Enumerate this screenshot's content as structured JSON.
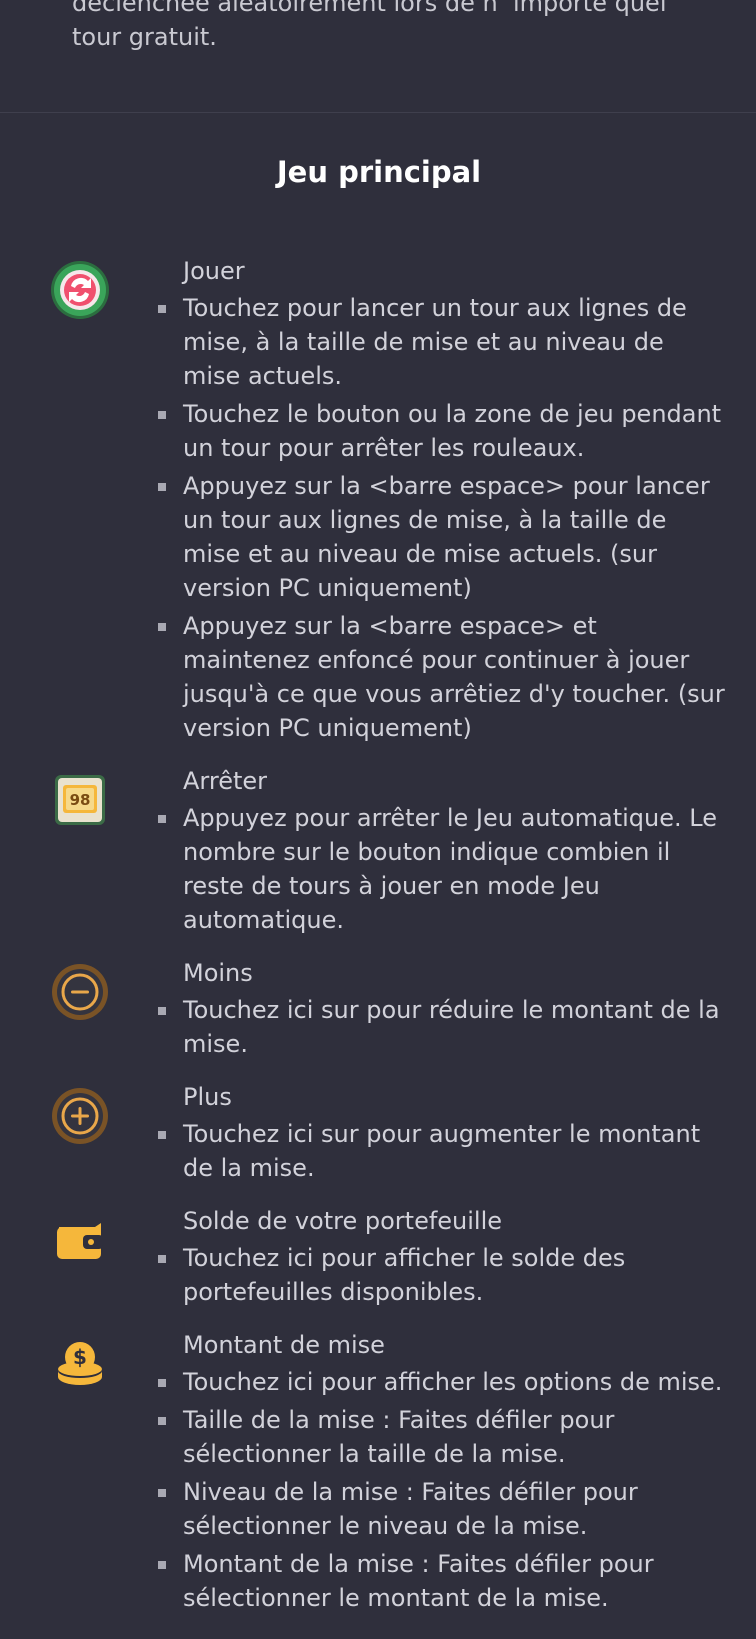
{
  "top": {
    "text": "déclenchée aléatoirement lors de n’ importe quel tour gratuit."
  },
  "section": {
    "title": "Jeu principal"
  },
  "items": [
    {
      "icon": "spin-icon",
      "title": "Jouer",
      "bullets": [
        "Touchez pour lancer un tour aux lignes de mise, à la taille de mise et au niveau de mise actuels.",
        "Touchez le bouton ou la zone de jeu pendant un tour pour arrêter les rouleaux.",
        "Appuyez sur la <barre espace> pour lancer un tour aux lignes de mise, à la taille de mise et au niveau de mise actuels. (sur version PC uniquement)",
        "Appuyez sur la <barre espace> et maintenez enfoncé pour continuer à jouer jusqu'à ce que vous arrêtiez d'y toucher. (sur version PC uniquement)"
      ]
    },
    {
      "icon": "autoplay-stop-icon",
      "icon_text": "98",
      "title": "Arrêter",
      "bullets": [
        "Appuyez pour arrêter le Jeu automatique. Le nombre sur le bouton indique combien il reste de tours à jouer en mode Jeu automatique."
      ]
    },
    {
      "icon": "minus-icon",
      "title": "Moins",
      "bullets": [
        "Touchez ici sur pour réduire le montant de la mise."
      ]
    },
    {
      "icon": "plus-icon",
      "title": "Plus",
      "bullets": [
        "Touchez ici sur pour augmenter le montant de la mise."
      ]
    },
    {
      "icon": "wallet-icon",
      "title": "Solde de votre portefeuille",
      "bullets": [
        "Touchez ici pour afficher le solde des portefeuilles disponibles."
      ]
    },
    {
      "icon": "coins-icon",
      "title": "Montant de mise",
      "bullets": [
        "Touchez ici pour afficher les options de mise.",
        "Taille de la mise : Faites défiler pour sélectionner la taille de la mise.",
        "Niveau de la mise : Faites défiler pour sélectionner le niveau de la mise.",
        "Montant de la mise : Faites défiler pour sélectionner le montant de la mise."
      ]
    }
  ],
  "colors": {
    "background": "#2f2f3c",
    "accent_gold": "#f5b73b",
    "spin_green": "#3aa55a",
    "spin_pink": "#f0506e"
  }
}
